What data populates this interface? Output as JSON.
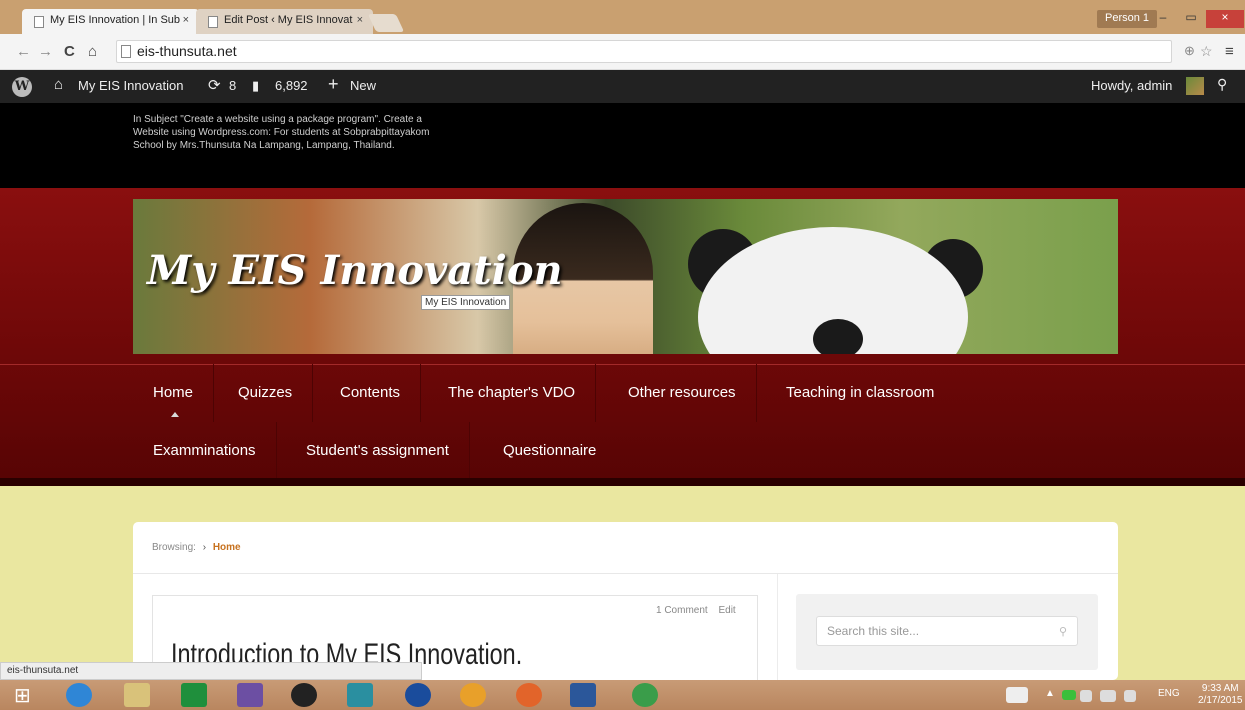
{
  "browser": {
    "tabs": [
      {
        "label": "My EIS Innovation | In Sub"
      },
      {
        "label": "Edit Post ‹ My EIS Innovat"
      }
    ],
    "close_glyph": "×",
    "profile": "Person 1",
    "window_controls": {
      "minimize": "–",
      "maximize": "▭",
      "close": "×"
    },
    "url": "eis-thunsuta.net",
    "nav": {
      "back": "←",
      "forward": "→",
      "reload": "C",
      "home": "⌂",
      "zoom": "⊕",
      "star": "☆",
      "menu": "≡"
    }
  },
  "admin_bar": {
    "site_name": "My EIS Innovation",
    "updates": "8",
    "comments": "6,892",
    "new_label": "New",
    "greeting": "Howdy, admin",
    "icons": {
      "wp": "W",
      "home": "⌂",
      "updates": "⟳",
      "comments": "▮",
      "new": "+",
      "search": "⚲"
    }
  },
  "site": {
    "description": "In Subject \"Create a website using a package program\". Create a Website using Wordpress.com: For students at Sobprabpittayakom School by Mrs.Thunsuta Na Lampang, Lampang, Thailand.",
    "title": "My EIS Innovation",
    "title_tooltip": "My EIS Innovation"
  },
  "menu": {
    "row1": [
      "Home",
      "Quizzes",
      "Contents",
      "The chapter's VDO",
      "Other resources",
      "Teaching in classroom"
    ],
    "row2": [
      "Examminations",
      "Student's assignment",
      "Questionnaire"
    ]
  },
  "breadcrumb": {
    "prefix": "Browsing:",
    "arrow": "›",
    "current": "Home"
  },
  "post": {
    "comments": "1 Comment",
    "edit": "Edit",
    "title": "Introduction to My EIS Innovation."
  },
  "search": {
    "placeholder": "Search this site..."
  },
  "status_url": "eis-thunsuta.net",
  "taskbar": {
    "tray_lang": "ENG",
    "time": "9:33 AM",
    "date": "2/17/2015",
    "start": "⊞",
    "tray_up": "▲"
  }
}
